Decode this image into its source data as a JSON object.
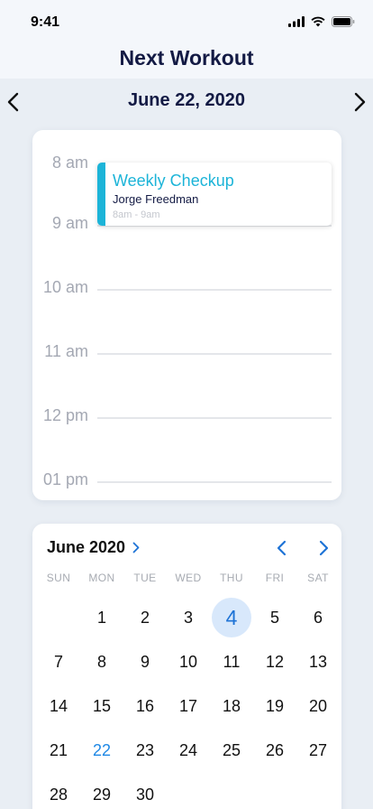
{
  "status_bar": {
    "time": "9:41"
  },
  "header": {
    "title": "Next Workout"
  },
  "date_nav": {
    "date": "June 22, 2020"
  },
  "schedule": {
    "hours": [
      "8 am",
      "9 am",
      "10 am",
      "11 am",
      "12 pm",
      "01 pm"
    ],
    "event": {
      "title": "Weekly Checkup",
      "person": "Jorge Freedman",
      "time": "8am - 9am",
      "color": "#1cb4d8"
    }
  },
  "calendar": {
    "month": "June 2020",
    "weekdays": [
      "SUN",
      "MON",
      "TUE",
      "WED",
      "THU",
      "FRI",
      "SAT"
    ],
    "selected_day": "4",
    "today": "22",
    "days": [
      "1",
      "2",
      "3",
      "4",
      "5",
      "6",
      "7",
      "8",
      "9",
      "10",
      "11",
      "12",
      "13",
      "14",
      "15",
      "16",
      "17",
      "18",
      "19",
      "20",
      "21",
      "22",
      "23",
      "24",
      "25",
      "26",
      "27",
      "28",
      "29",
      "30"
    ],
    "accent": "#1e73d6"
  }
}
